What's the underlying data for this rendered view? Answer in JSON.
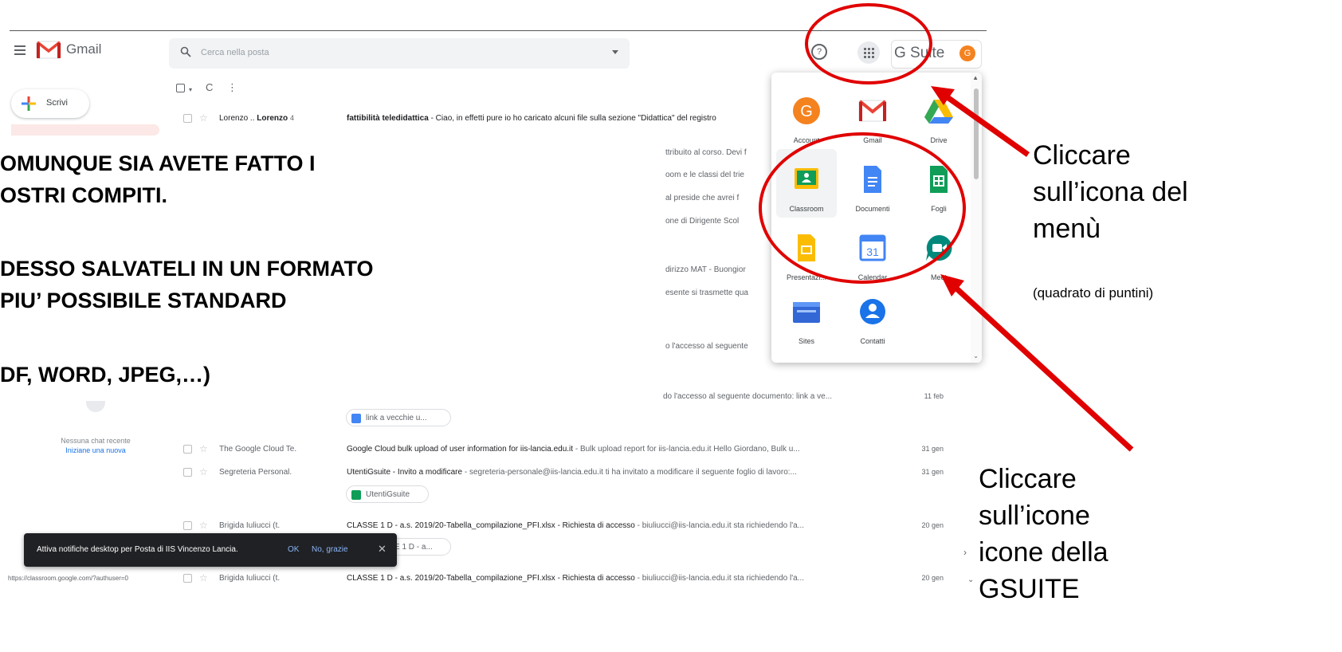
{
  "gmail": {
    "app_name": "Gmail",
    "search_placeholder": "Cerca nella posta",
    "help_glyph": "?",
    "gsuite_label": "G Suite",
    "avatar_letter": "G",
    "compose_label": "Scrivi"
  },
  "toolbar": {
    "caret": "▾",
    "refresh": "C",
    "more": "⋮"
  },
  "emails": [
    {
      "sender": "Lorenzo .. ",
      "sender_bold": "Lorenzo",
      "count": "4",
      "subject": "fattibilità teledidattica",
      "snippet": " - Ciao, in effetti pure io ho caricato alcuni file sulla sezione \"Didattica\" del registro",
      "date": ""
    },
    {
      "sender": "",
      "sender_bold": "",
      "count": "",
      "subject": "",
      "snippet": "do l'accesso al seguente documento: link a ve...",
      "date": "11 feb"
    },
    {
      "sender": "The Google Cloud Te.",
      "sender_bold": "",
      "count": "",
      "subject": "Google Cloud bulk upload of user information for iis-lancia.edu.it",
      "snippet": " - Bulk upload report for iis-lancia.edu.it Hello Giordano, Bulk u...",
      "date": "31 gen"
    },
    {
      "sender": "Segreteria Personal.",
      "sender_bold": "",
      "count": "",
      "subject": "UtentiGsuite - Invito a modificare",
      "snippet": " - segreteria-personale@iis-lancia.edu.it ti ha invitato a modificare il seguente foglio di lavoro:...",
      "date": "31 gen"
    },
    {
      "sender": "Brigida Iuliucci (t.",
      "sender_bold": "",
      "count": "",
      "subject": "CLASSE 1 D - a.s. 2019/20-Tabella_compilazione_PFI.xlsx - Richiesta di accesso",
      "snippet": " - biuliucci@iis-lancia.edu.it sta richiedendo l'a...",
      "date": "20 gen"
    },
    {
      "sender": "Brigida Iuliucci (t.",
      "sender_bold": "",
      "count": "",
      "subject": "CLASSE 1 D - a.s. 2019/20-Tabella_compilazione_PFI.xlsx - Richiesta di accesso",
      "snippet": " - biuliucci@iis-lancia.edu.it sta richiedendo l'a...",
      "date": "20 gen"
    }
  ],
  "chips": {
    "link": "link a vecchie u...",
    "utenti": "UtentiGsuite",
    "classe": "E 1 D - a..."
  },
  "snippet_fragments": [
    "ttribuito al corso. Devi f",
    "oom e le classi del trie",
    "al preside che avrei f",
    "one di Dirigente Scol",
    "dirizzo MAT - Buongior",
    "esente si trasmette qua",
    "o l'accesso al seguente"
  ],
  "slide_text": {
    "line1": "OMUNQUE SIA AVETE FATTO I",
    "line2": "OSTRI COMPITI.",
    "line3": "DESSO SALVATELI IN UN FORMATO",
    "line4": " PIU’ POSSIBILE STANDARD",
    "line5": "DF, WORD, JPEG,…)"
  },
  "chat": {
    "empty": "Nessuna chat recente",
    "start_new": "Iniziane una nuova"
  },
  "snackbar": {
    "text": "Attiva notifiche desktop per Posta di IIS Vincenzo Lancia.",
    "ok": "OK",
    "no": "No, grazie",
    "close": "✕"
  },
  "status_url": "https://classroom.google.com/?authuser=0",
  "apps": [
    {
      "label": "Account",
      "icon": "account-icon"
    },
    {
      "label": "Gmail",
      "icon": "gmail-icon"
    },
    {
      "label": "Drive",
      "icon": "drive-icon"
    },
    {
      "label": "Classroom",
      "icon": "classroom-icon"
    },
    {
      "label": "Documenti",
      "icon": "docs-icon"
    },
    {
      "label": "Fogli",
      "icon": "sheets-icon"
    },
    {
      "label": "Presentazi...",
      "icon": "slides-icon"
    },
    {
      "label": "Calendar",
      "icon": "calendar-icon",
      "glyph": "31"
    },
    {
      "label": "Meet",
      "icon": "meet-icon"
    },
    {
      "label": "Sites",
      "icon": "sites-icon"
    },
    {
      "label": "Contatti",
      "icon": "contacts-icon"
    }
  ],
  "annotations": {
    "callout1": [
      "Cliccare",
      "sull’icona del",
      "menù"
    ],
    "callout1_small": "(quadrato di puntini)",
    "callout2": [
      "Cliccare",
      "sull’icone",
      "icone della",
      "GSUITE"
    ]
  },
  "colors": {
    "annotation_red": "#e00000",
    "gmail_red": "#ea4335",
    "snackbar_bg": "#202124",
    "link_blue": "#1a73e8",
    "avatar_orange": "#f4821f"
  }
}
